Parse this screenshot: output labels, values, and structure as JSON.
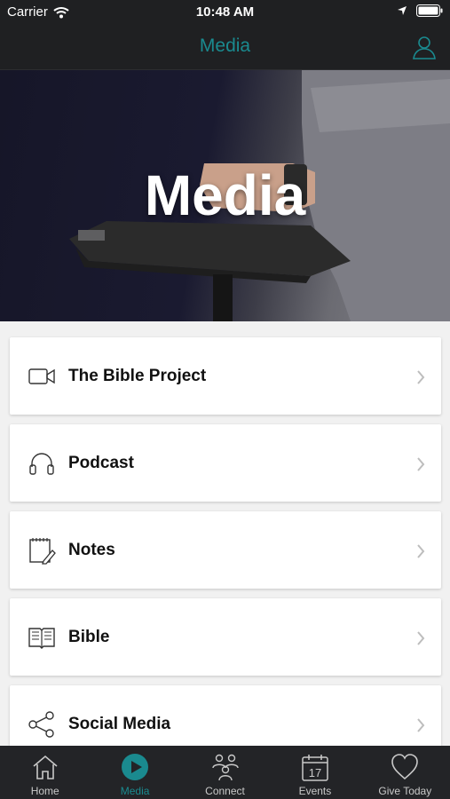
{
  "status_bar": {
    "carrier": "Carrier",
    "time": "10:48 AM"
  },
  "nav": {
    "title": "Media",
    "profile_icon": "person-icon"
  },
  "hero": {
    "title": "Media"
  },
  "menu": {
    "items": [
      {
        "label": "The Bible Project",
        "icon": "video-camera-icon"
      },
      {
        "label": "Podcast",
        "icon": "headphones-icon"
      },
      {
        "label": "Notes",
        "icon": "notepad-icon"
      },
      {
        "label": "Bible",
        "icon": "book-icon"
      },
      {
        "label": "Social Media",
        "icon": "share-icon"
      }
    ]
  },
  "tabs": [
    {
      "label": "Home",
      "icon": "home-icon",
      "active": false
    },
    {
      "label": "Media",
      "icon": "play-icon",
      "active": true
    },
    {
      "label": "Connect",
      "icon": "people-icon",
      "active": false
    },
    {
      "label": "Events",
      "icon": "calendar-icon",
      "active": false,
      "calendar_day": "17"
    },
    {
      "label": "Give Today",
      "icon": "heart-icon",
      "active": false
    }
  ],
  "colors": {
    "accent": "#1a8a8f",
    "bar_bg": "#1f2022",
    "tab_bg": "#232427",
    "list_bg": "#f1f1f1"
  }
}
